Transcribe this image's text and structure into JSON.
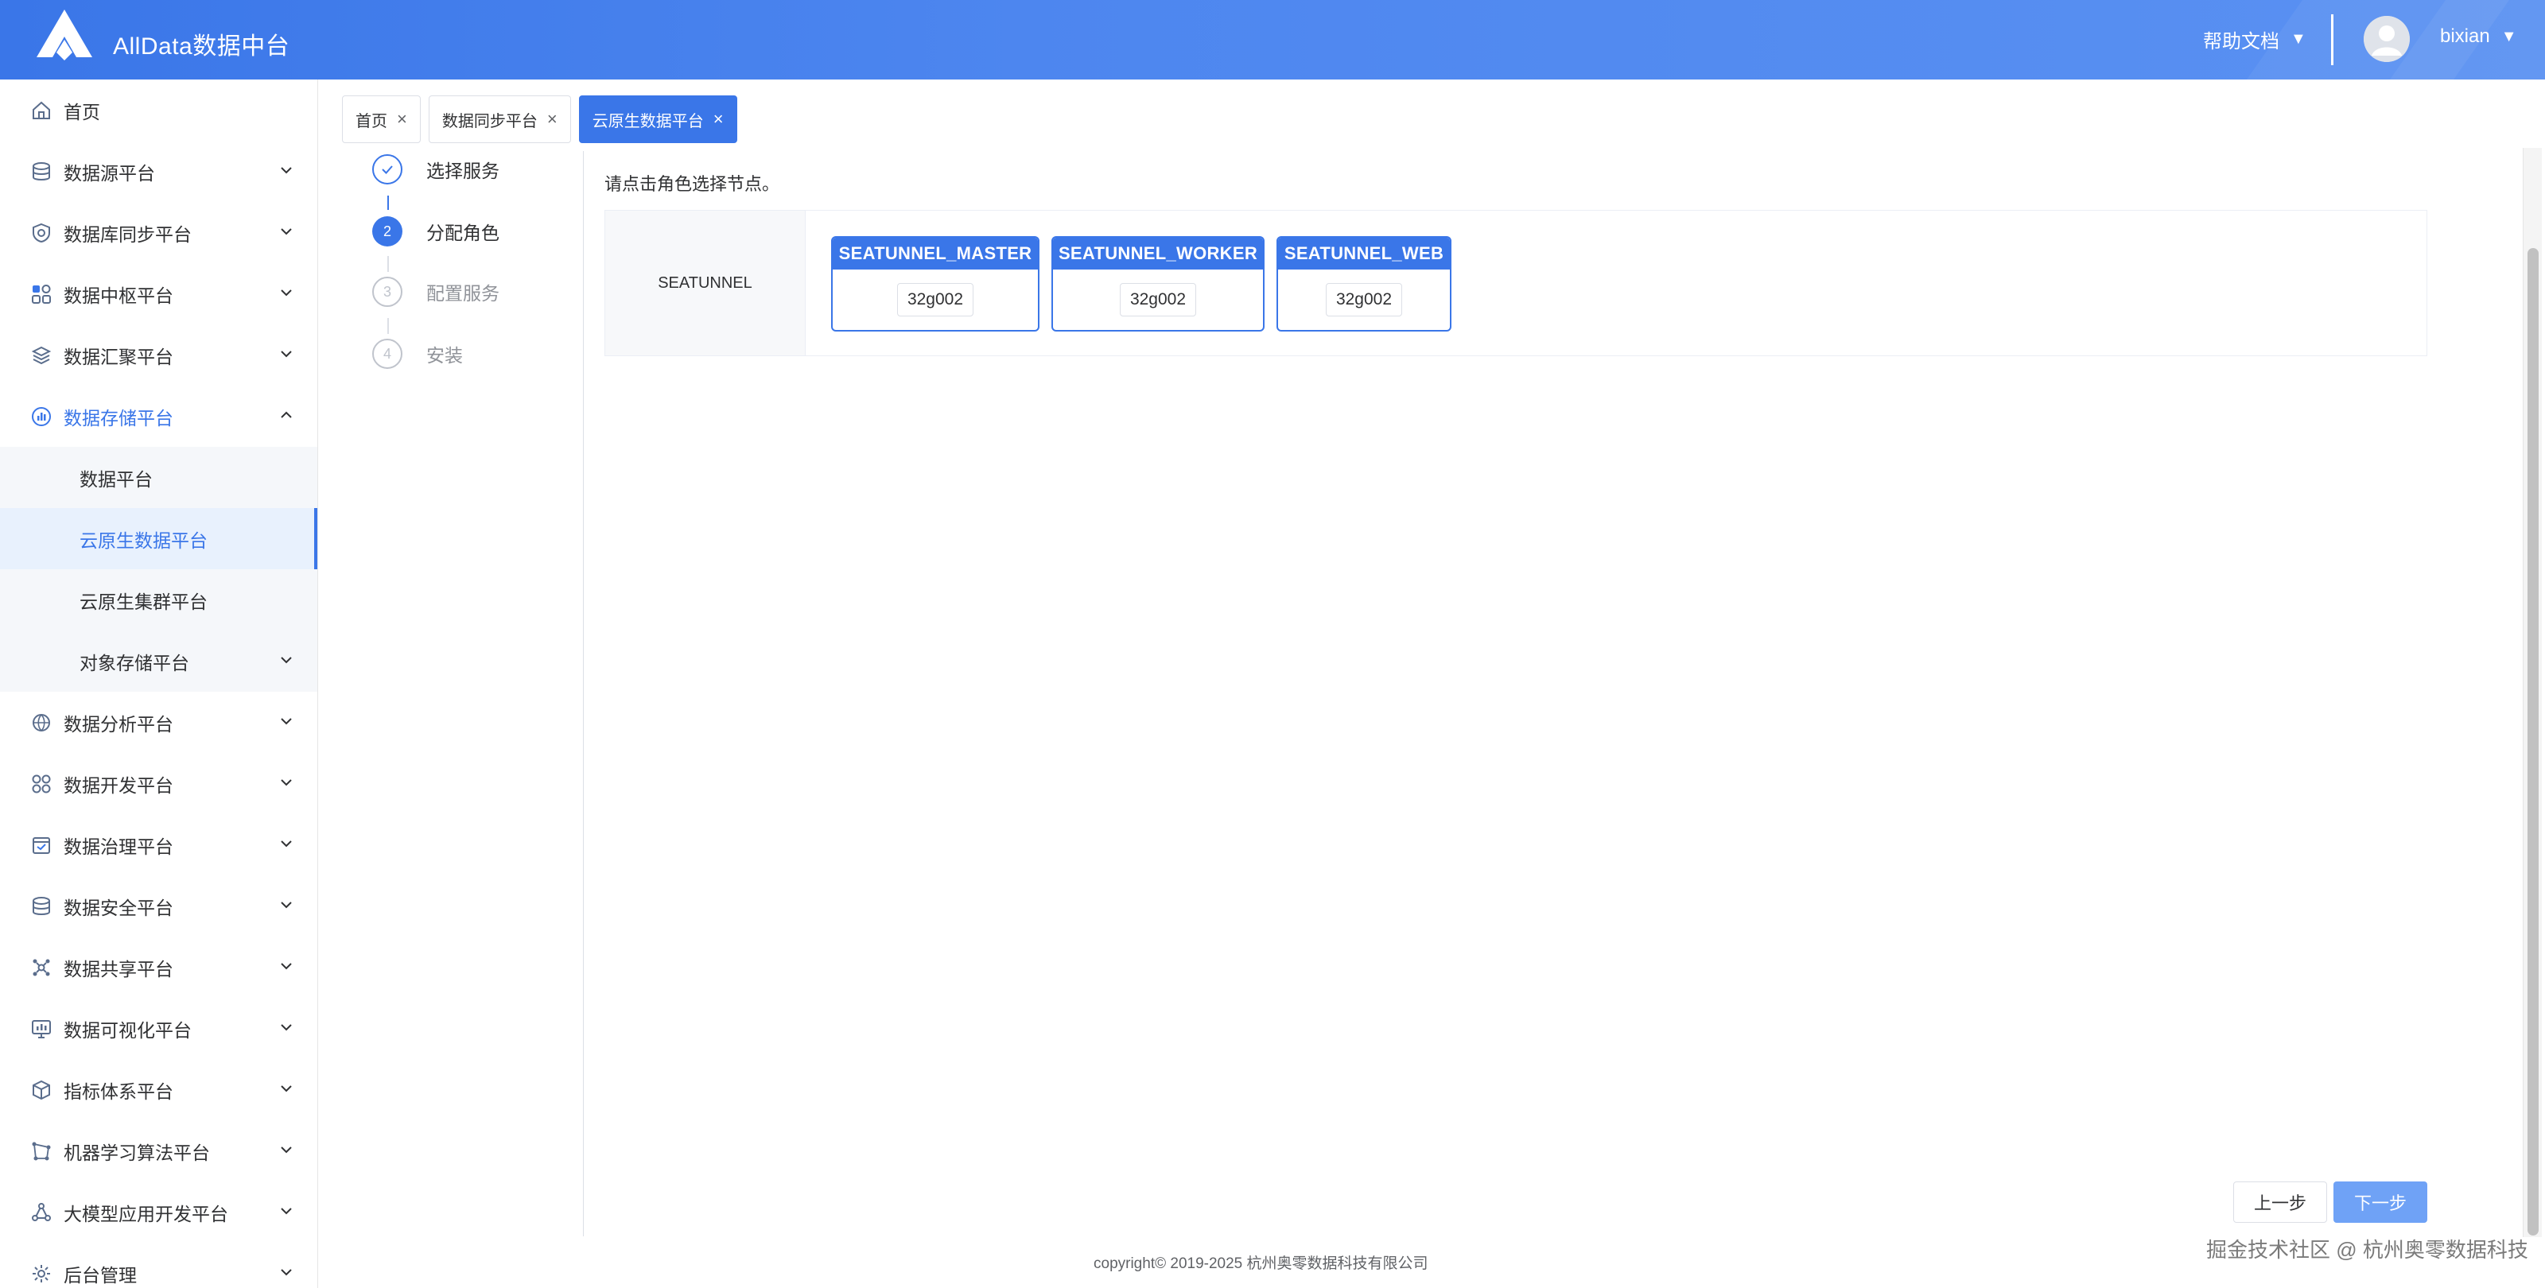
{
  "header": {
    "app_title": "AllData数据中台",
    "help_label": "帮助文档",
    "username": "bixian",
    "dropdown_glyph": "▼"
  },
  "sidebar": {
    "items": [
      {
        "label": "首页",
        "icon": "home-icon"
      },
      {
        "label": "数据源平台",
        "icon": "database-icon"
      },
      {
        "label": "数据库同步平台",
        "icon": "sync-icon"
      },
      {
        "label": "数据中枢平台",
        "icon": "grid-icon"
      },
      {
        "label": "数据汇聚平台",
        "icon": "layers-icon"
      },
      {
        "label": "数据存储平台",
        "icon": "storage-icon"
      },
      {
        "label": "数据分析平台",
        "icon": "analysis-icon"
      },
      {
        "label": "数据开发平台",
        "icon": "develop-icon"
      },
      {
        "label": "数据治理平台",
        "icon": "governance-icon"
      },
      {
        "label": "数据安全平台",
        "icon": "security-icon"
      },
      {
        "label": "数据共享平台",
        "icon": "share-icon"
      },
      {
        "label": "数据可视化平台",
        "icon": "visual-icon"
      },
      {
        "label": "指标体系平台",
        "icon": "cube-icon"
      },
      {
        "label": "机器学习算法平台",
        "icon": "ml-icon"
      },
      {
        "label": "大模型应用开发平台",
        "icon": "llm-icon"
      },
      {
        "label": "后台管理",
        "icon": "admin-icon"
      }
    ],
    "storage_sub": [
      {
        "label": "数据平台"
      },
      {
        "label": "云原生数据平台"
      },
      {
        "label": "云原生集群平台"
      },
      {
        "label": "对象存储平台"
      }
    ]
  },
  "tabs": [
    {
      "label": "首页"
    },
    {
      "label": "数据同步平台"
    },
    {
      "label": "云原生数据平台"
    }
  ],
  "tab_close_glyph": "×",
  "steps": [
    {
      "index": "1",
      "label": "选择服务",
      "status": "done"
    },
    {
      "index": "2",
      "label": "分配角色",
      "status": "current"
    },
    {
      "index": "3",
      "label": "配置服务",
      "status": "pending"
    },
    {
      "index": "4",
      "label": "安装",
      "status": "pending"
    }
  ],
  "main": {
    "instruction": "请点击角色选择节点。",
    "service_name": "SEATUNNEL",
    "roles": [
      {
        "name": "SEATUNNEL_MASTER",
        "node": "32g002"
      },
      {
        "name": "SEATUNNEL_WORKER",
        "node": "32g002"
      },
      {
        "name": "SEATUNNEL_WEB",
        "node": "32g002"
      }
    ]
  },
  "buttons": {
    "prev": "上一步",
    "next": "下一步"
  },
  "footer": {
    "copyright": "copyright© 2019-2025 杭州奥零数据科技有限公司",
    "watermark": "掘金技术社区 @ 杭州奥零数据科技"
  },
  "colors": {
    "primary": "#3a76e8",
    "header_gradient_end": "#5a91f2",
    "next_button": "#6fa2f6"
  }
}
